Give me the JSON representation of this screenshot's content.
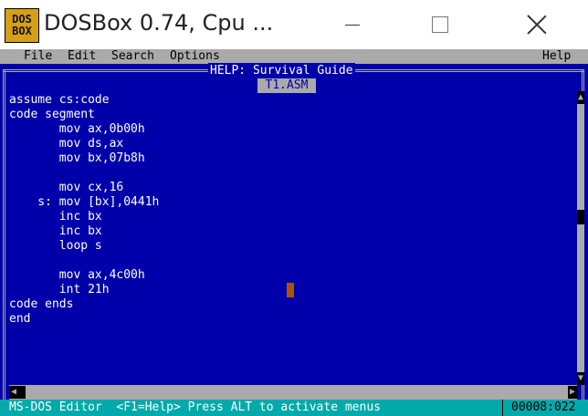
{
  "window": {
    "title": "DOSBox 0.74, Cpu ...",
    "icon_lines": [
      "DOS",
      "BOX"
    ],
    "buttons": [
      "minimize-icon",
      "maximize-icon",
      "close-icon"
    ]
  },
  "menubar": {
    "items": [
      "File",
      "Edit",
      "Search",
      "Options"
    ],
    "help": "Help"
  },
  "help_title": "HELP: Survival Guide",
  "file_tab": "T1.ASM",
  "code_lines": [
    "assume cs:code",
    "code segment",
    "       mov ax,0b00h",
    "       mov ds,ax",
    "       mov bx,07b8h",
    "",
    "       mov cx,16",
    "    s: mov [bx],0441h",
    "       inc bx",
    "       inc bx",
    "       loop s",
    "",
    "       mov ax,4c00h",
    "       int 21h",
    "code ends",
    "end"
  ],
  "statusbar": {
    "text": "MS-DOS Editor  <F1=Help> Press ALT to activate menus",
    "position": "00008:022"
  },
  "colors": {
    "dos_background": "#0000aa",
    "menu_background": "#aaaaaa",
    "status_background": "#00aaaa",
    "cursor": "#aa5500"
  }
}
